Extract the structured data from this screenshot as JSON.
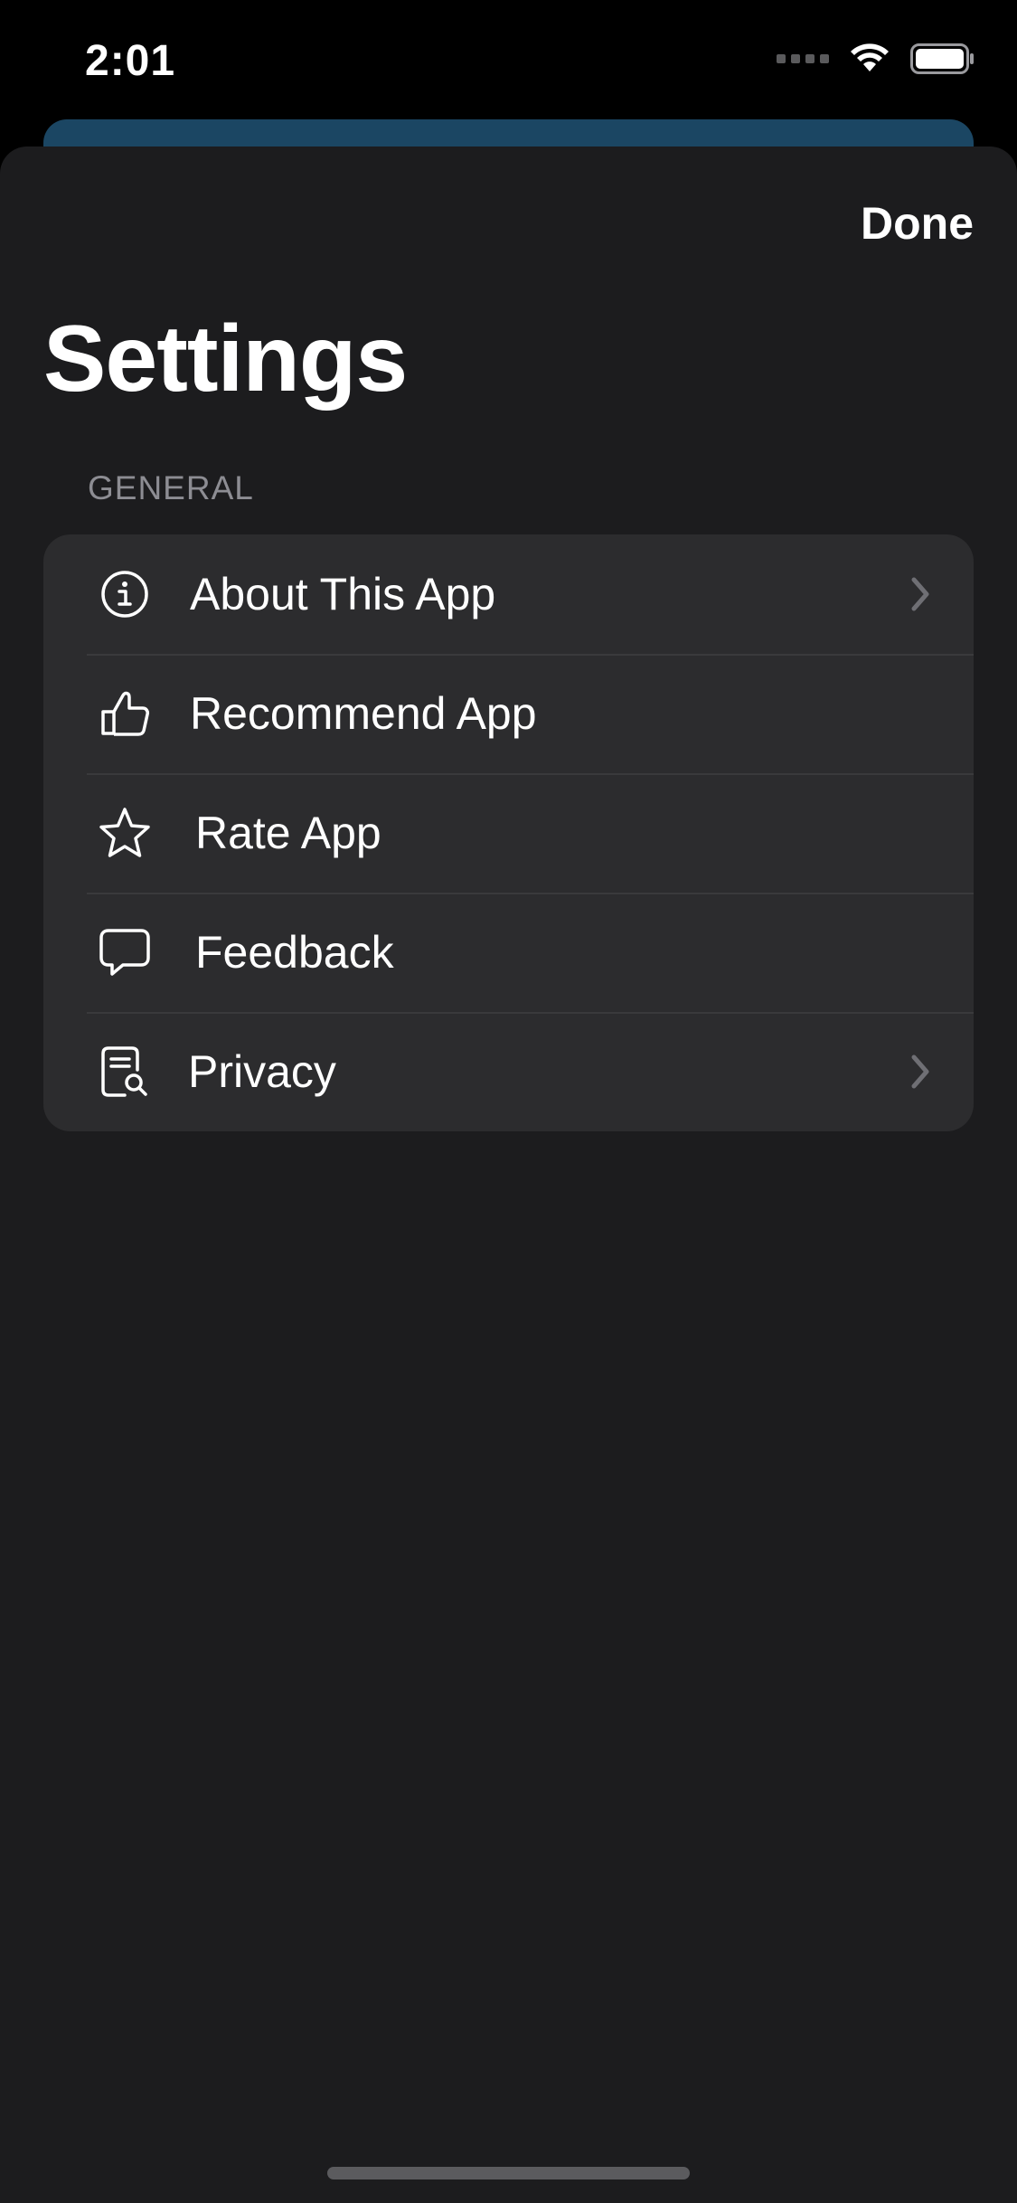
{
  "status_bar": {
    "time": "2:01"
  },
  "header": {
    "done_label": "Done",
    "title": "Settings"
  },
  "general_section": {
    "header": "GENERAL",
    "items": [
      {
        "label": "About This App",
        "icon": "info-circle-icon",
        "chevron": true
      },
      {
        "label": "Recommend App",
        "icon": "thumbs-up-icon",
        "chevron": false
      },
      {
        "label": "Rate App",
        "icon": "star-icon",
        "chevron": false
      },
      {
        "label": "Feedback",
        "icon": "message-bubble-icon",
        "chevron": false
      },
      {
        "label": "Privacy",
        "icon": "document-search-icon",
        "chevron": true
      }
    ]
  },
  "colors": {
    "background": "#000000",
    "sheet": "#1c1c1e",
    "group": "#2c2c2e",
    "separator": "#3a3a3c",
    "secondary_text": "#8d8d93",
    "behind_card": "#1b4663"
  }
}
